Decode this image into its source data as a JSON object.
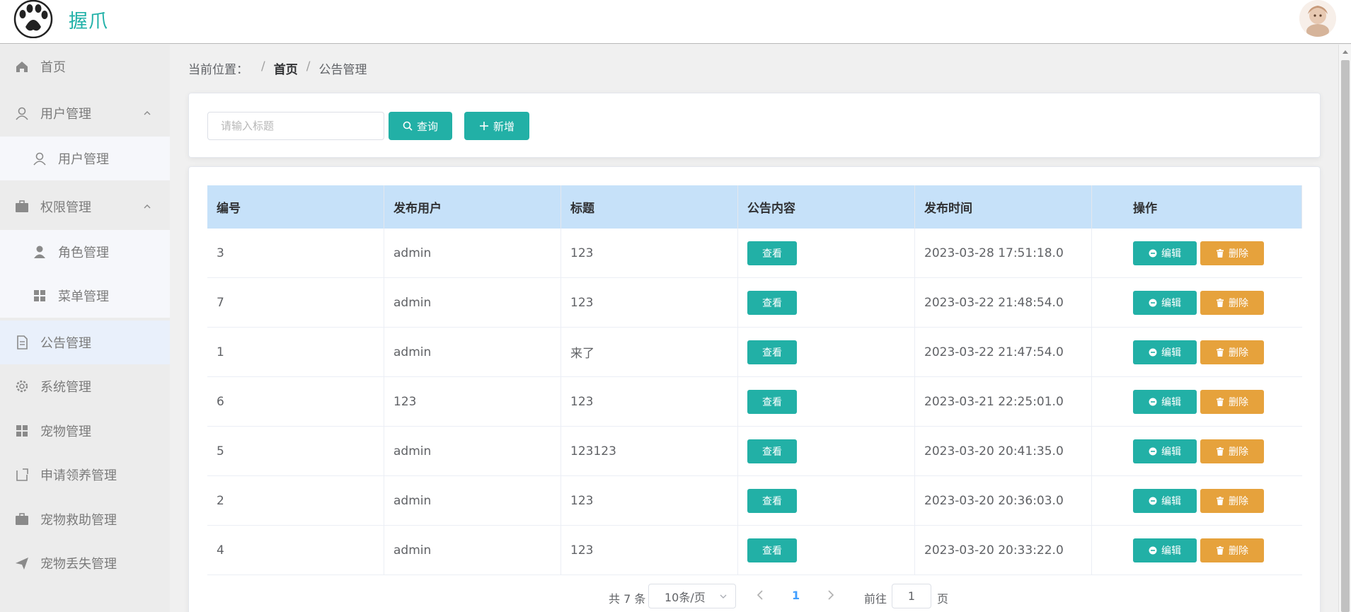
{
  "app": {
    "brand": "握爪",
    "colors": {
      "accent": "#22b0a6",
      "danger": "#e6a23c",
      "header_row": "#c6e1f9",
      "link": "#409eff"
    }
  },
  "sidebar": {
    "items": [
      {
        "label": "首页",
        "icon": "home-icon"
      },
      {
        "label": "用户管理",
        "icon": "user-icon",
        "expanded": true
      },
      {
        "label": "用户管理",
        "icon": "user-icon",
        "sub": true
      },
      {
        "label": "权限管理",
        "icon": "briefcase-icon",
        "expanded": true
      },
      {
        "label": "角色管理",
        "icon": "person-icon",
        "sub": true
      },
      {
        "label": "菜单管理",
        "icon": "grid-icon",
        "sub": true
      },
      {
        "label": "公告管理",
        "icon": "document-icon",
        "active": true
      },
      {
        "label": "系统管理",
        "icon": "gear-icon"
      },
      {
        "label": "宠物管理",
        "icon": "grid-icon"
      },
      {
        "label": "申请领养管理",
        "icon": "edit-box-icon"
      },
      {
        "label": "宠物救助管理",
        "icon": "briefcase-icon"
      },
      {
        "label": "宠物丢失管理",
        "icon": "send-icon"
      }
    ]
  },
  "breadcrumb": {
    "prefix": "当前位置：",
    "separator": "/",
    "home": "首页",
    "current": "公告管理"
  },
  "search": {
    "placeholder": "请输入标题",
    "query_label": "查询",
    "add_label": "新增"
  },
  "table": {
    "columns": [
      "编号",
      "发布用户",
      "标题",
      "公告内容",
      "发布时间",
      "操作"
    ],
    "view_label": "查看",
    "edit_label": "编辑",
    "delete_label": "删除",
    "rows": [
      {
        "id": "3",
        "user": "admin",
        "title": "123",
        "time": "2023-03-28 17:51:18.0"
      },
      {
        "id": "7",
        "user": "admin",
        "title": "123",
        "time": "2023-03-22 21:48:54.0"
      },
      {
        "id": "1",
        "user": "admin",
        "title": "来了",
        "time": "2023-03-22 21:47:54.0"
      },
      {
        "id": "6",
        "user": "123",
        "title": "123",
        "time": "2023-03-21 22:25:01.0"
      },
      {
        "id": "5",
        "user": "admin",
        "title": "123123",
        "time": "2023-03-20 20:41:35.0"
      },
      {
        "id": "2",
        "user": "admin",
        "title": "123",
        "time": "2023-03-20 20:36:03.0"
      },
      {
        "id": "4",
        "user": "admin",
        "title": "123",
        "time": "2023-03-20 20:33:22.0"
      }
    ]
  },
  "pagination": {
    "total": "共 7 条",
    "page_size": "10条/页",
    "current_page": "1",
    "goto_prefix": "前往",
    "goto_value": "1",
    "goto_suffix": "页"
  }
}
